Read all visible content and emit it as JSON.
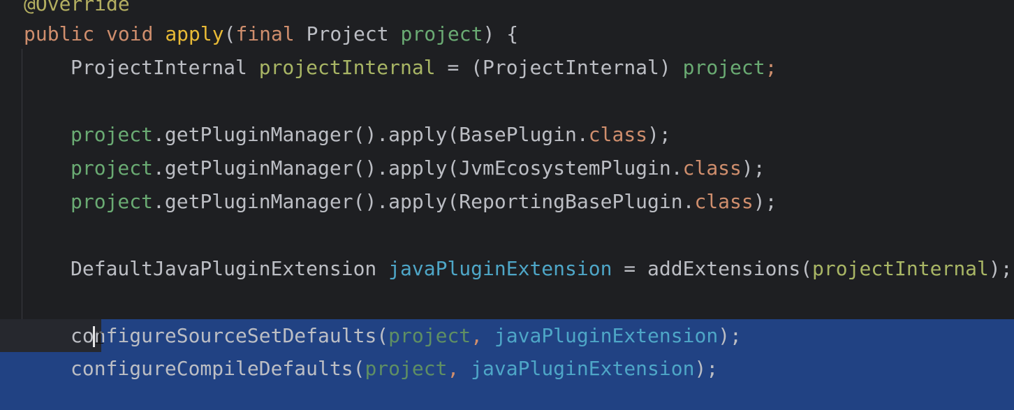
{
  "editor": {
    "colors": {
      "background": "#1e1f22",
      "selection": "#214283",
      "caret_line": "#26282e",
      "keyword": "#cf8e6d",
      "method": "#e8ba36",
      "parameter": "#6aab73",
      "field": "#4ea6c7",
      "text": "#bcbec4"
    },
    "lines": {
      "l0": {
        "annotation": "@Override"
      },
      "l1": {
        "kw1": "public",
        "kw2": "void",
        "fn": "apply",
        "p1": "(",
        "kw3": "final",
        "type": " Project ",
        "param": "project",
        "p2": ") {"
      },
      "l2": {
        "type": "ProjectInternal ",
        "var": "projectInternal",
        "mid": " = (ProjectInternal) ",
        "param": "project",
        "end": ";"
      },
      "l3": {
        "param": "project",
        "mid": ".getPluginManager().apply(BasePlugin.",
        "kw": "class",
        "end": ");"
      },
      "l4": {
        "param": "project",
        "mid": ".getPluginManager().apply(JvmEcosystemPlugin.",
        "kw": "class",
        "end": ");"
      },
      "l5": {
        "param": "project",
        "mid": ".getPluginManager().apply(ReportingBasePlugin.",
        "kw": "class",
        "end": ");"
      },
      "l6": {
        "type": "DefaultJavaPluginExtension ",
        "var": "javaPluginExtension",
        "mid": " = addExtensions(",
        "arg": "projectInternal",
        "end": ");"
      },
      "l7": {
        "pre": "co",
        "post": "nfigureSourceSetDefaults(",
        "param": "project",
        "comma": ", ",
        "arg": "javaPluginExtension",
        "end": ");"
      },
      "l8": {
        "pre": "configureCompileDefaults(",
        "param": "project",
        "comma": ", ",
        "arg": "javaPluginExtension",
        "end": ");"
      }
    },
    "icons": {
      "text_cursor": "i-beam-icon"
    }
  }
}
